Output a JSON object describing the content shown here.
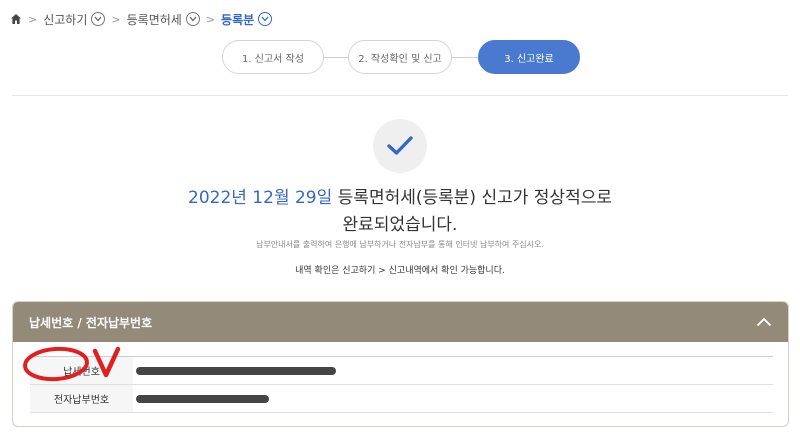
{
  "breadcrumb": {
    "items": [
      {
        "label": "신고하기"
      },
      {
        "label": "등록면허세"
      },
      {
        "label": "등록분"
      }
    ]
  },
  "steps": [
    {
      "label": "1. 신고서 작성",
      "active": false
    },
    {
      "label": "2. 작성확인 및 신고",
      "active": false
    },
    {
      "label": "3. 신고완료",
      "active": true
    }
  ],
  "result": {
    "date": "2022년 12월 29일",
    "message_rest": "등록면허세(등록분) 신고가 정상적으로",
    "message_line2": "완료되었습니다.",
    "notice": "납부안내서를 출력하여 은행에 납부하거나 전자납부를 통해 인터넷 납부하여 주십시오.",
    "history_notice": "내역 확인은 신고하기 > 신고내역에서 확인 가능합니다."
  },
  "panel": {
    "title": "납세번호 / 전자납부번호",
    "rows": [
      {
        "label": "납세번호"
      },
      {
        "label": "전자납부번호"
      }
    ]
  },
  "colors": {
    "accent": "#4a7ad0",
    "panel_header": "#938a79",
    "annotation": "#e02020"
  }
}
